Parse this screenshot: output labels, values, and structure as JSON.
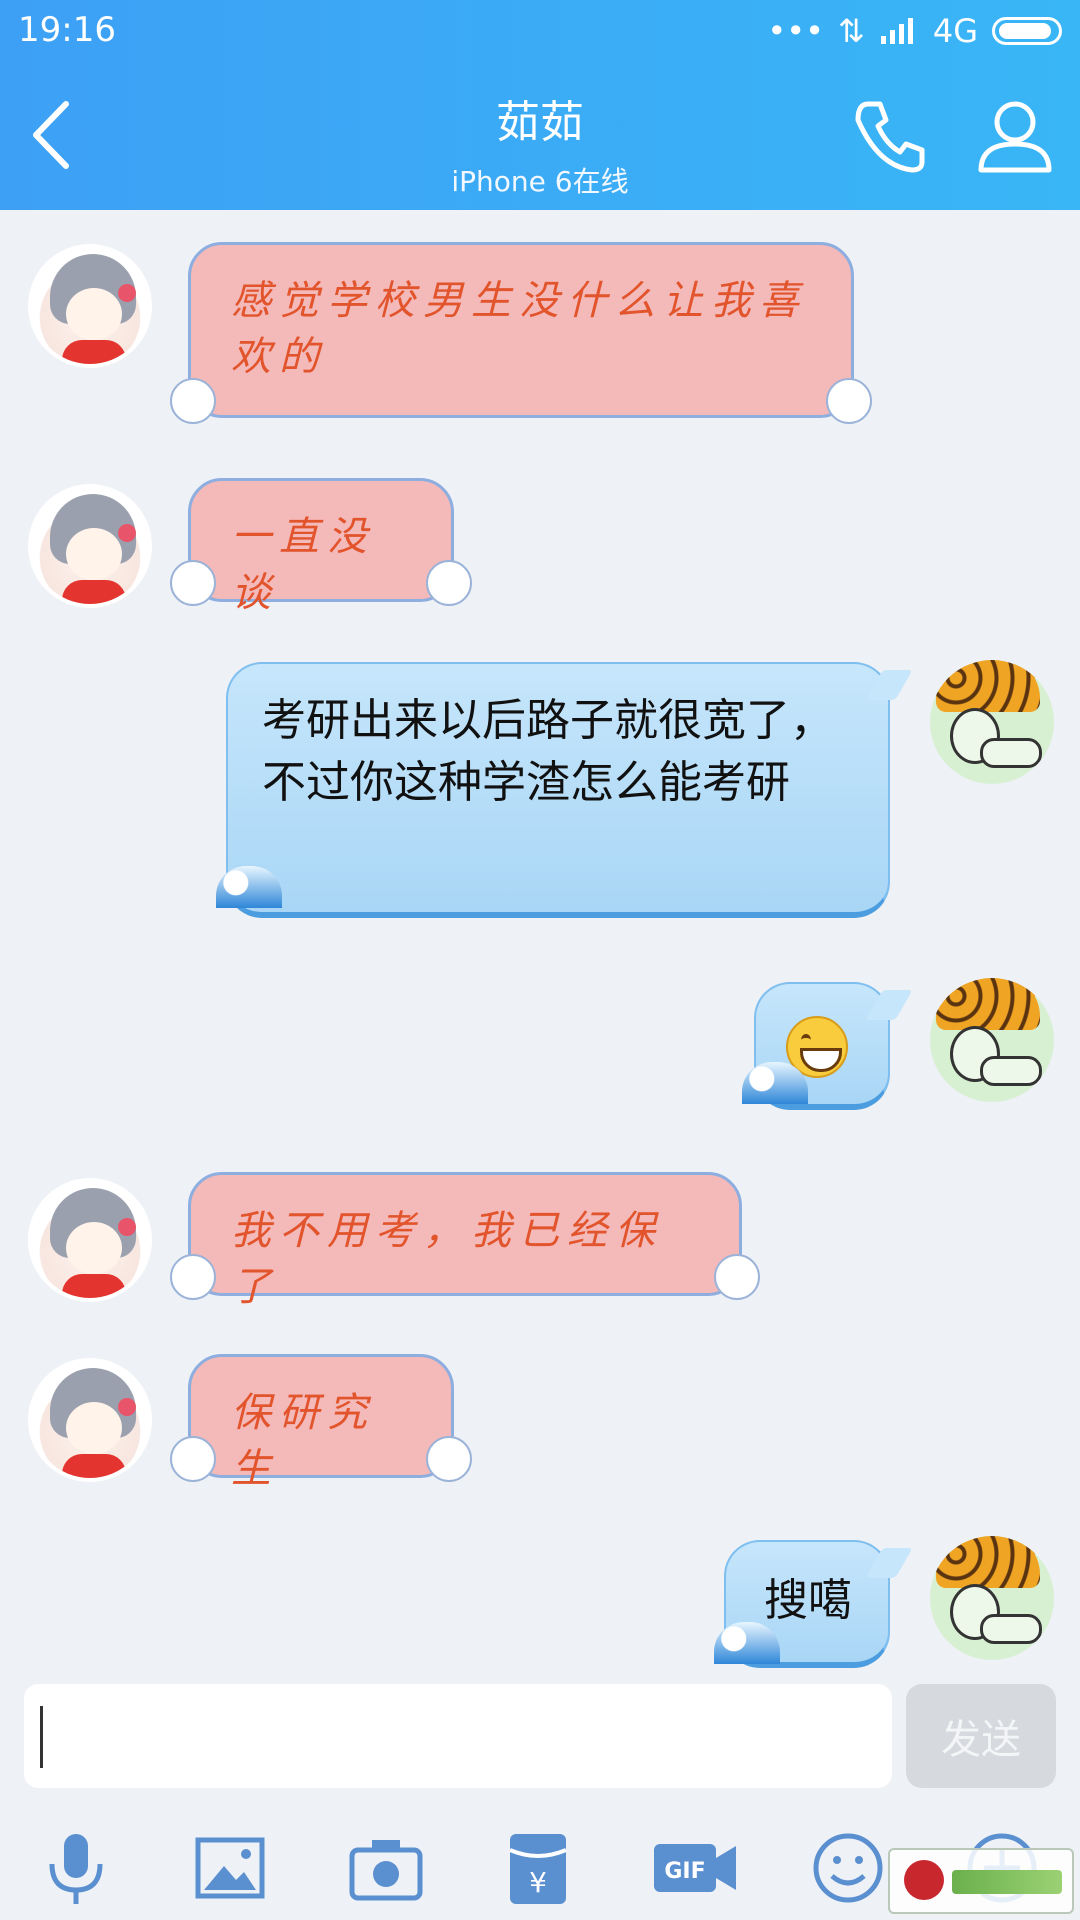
{
  "status_bar": {
    "time": "19:16",
    "network": "4G",
    "icons": [
      "more-dots-icon",
      "data-arrows-icon",
      "signal-icon",
      "battery-icon"
    ]
  },
  "header": {
    "title": "茹茹",
    "subtitle": "iPhone 6在线",
    "icons": [
      "back-icon",
      "phone-icon",
      "profile-icon"
    ]
  },
  "messages": [
    {
      "sender": "them",
      "text": "感觉学校男生没什么让我喜欢的"
    },
    {
      "sender": "them",
      "text": "一直没谈"
    },
    {
      "sender": "me",
      "text": "考研出来以后路子就很宽了，不过你这种学渣怎么能考研"
    },
    {
      "sender": "me",
      "emoji": "grinning-face"
    },
    {
      "sender": "them",
      "text": "我不用考，我已经保了"
    },
    {
      "sender": "them",
      "text": "保研究生"
    },
    {
      "sender": "me",
      "text": "搜噶"
    }
  ],
  "composer": {
    "input_value": "",
    "send_label": "发送"
  },
  "toolbar": [
    "microphone-icon",
    "image-icon",
    "camera-icon",
    "red-packet-icon",
    "gif-icon",
    "emoji-icon",
    "plus-icon"
  ],
  "colors": {
    "header_gradient_start": "#3da0f5",
    "header_gradient_end": "#39b6f6",
    "pink_bubble": "#f4b9b9",
    "pink_text": "#e2542c",
    "blue_bubble": "#bfe2fa",
    "background": "#eef1f6"
  }
}
